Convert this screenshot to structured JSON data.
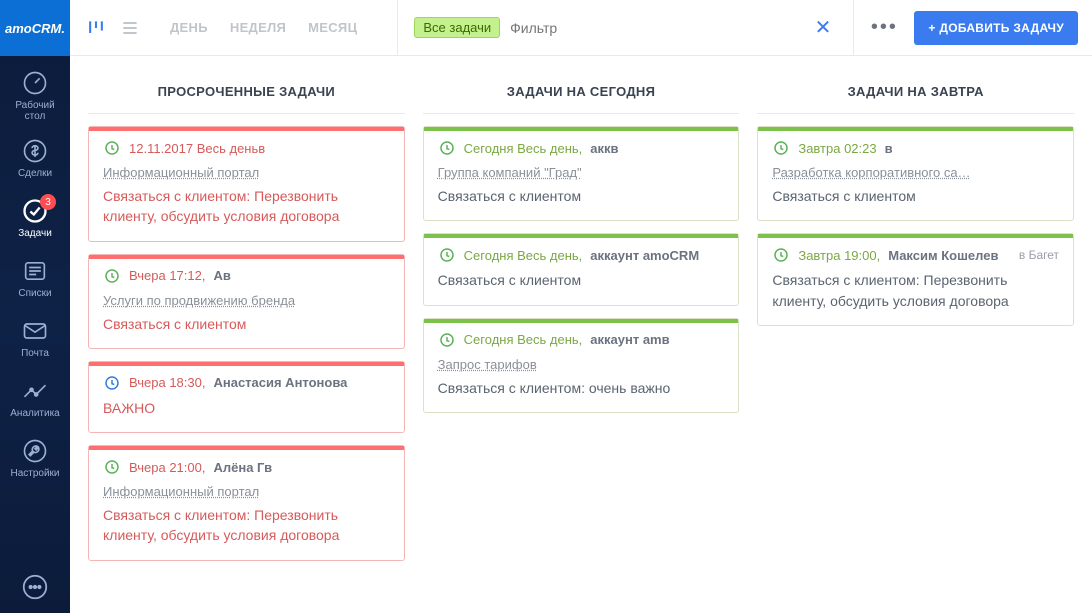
{
  "brand": "amoCRM.",
  "sidebar": {
    "items": [
      {
        "label": "Рабочий\nстол"
      },
      {
        "label": "Сделки"
      },
      {
        "label": "Задачи",
        "badge": "3"
      },
      {
        "label": "Списки"
      },
      {
        "label": "Почта"
      },
      {
        "label": "Аналитика"
      },
      {
        "label": "Настройки"
      }
    ]
  },
  "topbar": {
    "period": {
      "day": "ДЕНЬ",
      "week": "НЕДЕЛЯ",
      "month": "МЕСЯЦ"
    },
    "chip": "Все задачи",
    "filter_placeholder": "Фильтр",
    "add_button": "+ ДОБАВИТЬ ЗАДАЧУ"
  },
  "columns": {
    "overdue": {
      "title": "ПРОСРОЧЕННЫЕ ЗАДАЧИ",
      "cards": [
        {
          "time": "12.11.2017 Весь деньв",
          "link": "Информационный портал",
          "desc": "Связаться с клиентом: Перезвонить клиенту, обсудить условия договора",
          "icon": "green"
        },
        {
          "time": "Вчера 17:12,",
          "who": "Ав",
          "link": "Услуги по продвижению бренда",
          "desc": "Связаться с клиентом",
          "icon": "green"
        },
        {
          "time": "Вчера 18:30,",
          "who": "Анастасия Антонова",
          "desc": "ВАЖНО",
          "icon": "blue"
        },
        {
          "time": "Вчера 21:00,",
          "who": "Алёна Гв",
          "link": "Информационный портал",
          "desc": "Связаться с клиентом: Перезвонить клиенту, обсудить условия договора",
          "icon": "green"
        }
      ]
    },
    "today": {
      "title": "ЗАДАЧИ НА СЕГОДНЯ",
      "cards": [
        {
          "time": "Сегодня Весь день,",
          "who": "аккв",
          "link": "Группа компаний \"Град\"",
          "desc": "Связаться с клиентом",
          "icon": "green"
        },
        {
          "time": "Сегодня Весь день,",
          "who": "аккаунт amoCRM",
          "desc": "Связаться с клиентом",
          "icon": "green"
        },
        {
          "time": "Сегодня Весь день,",
          "who": "аккаунт amв",
          "link": "Запрос тарифов",
          "desc": "Связаться с клиентом: очень важно",
          "icon": "green"
        }
      ]
    },
    "tomorrow": {
      "title": "ЗАДАЧИ НА ЗАВТРА",
      "cards": [
        {
          "time": "Завтра 02:23",
          "who": "в",
          "link": "Разработка корпоративного са…",
          "desc": "Связаться с клиентом",
          "icon": "green"
        },
        {
          "time": "Завтра 19:00,",
          "who": "Максим Кошелев",
          "right": "в Багет",
          "desc": "Связаться с клиентом: Перезвонить клиенту, обсудить условия договора",
          "icon": "green"
        }
      ]
    }
  }
}
